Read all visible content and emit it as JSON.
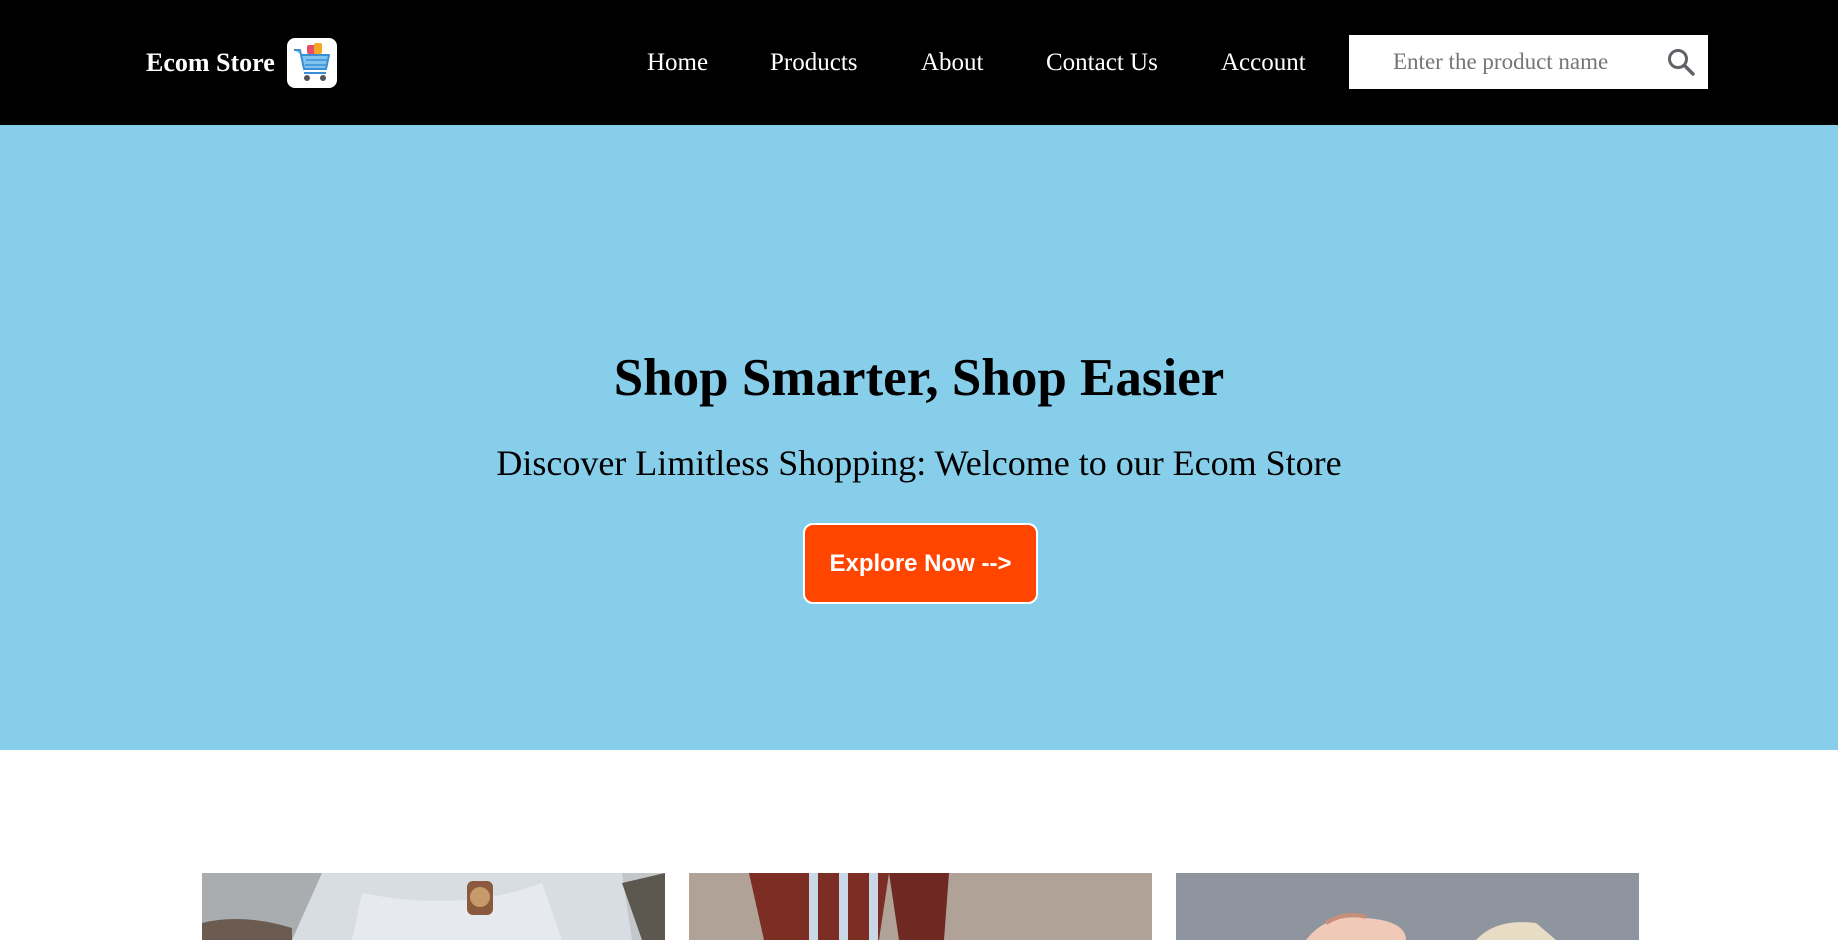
{
  "header": {
    "brand": "Ecom Store",
    "nav": [
      {
        "label": "Home"
      },
      {
        "label": "Products"
      },
      {
        "label": "About"
      },
      {
        "label": "Contact Us"
      },
      {
        "label": "Account"
      }
    ],
    "search": {
      "placeholder": "Enter the product name",
      "value": ""
    }
  },
  "hero": {
    "title": "Shop Smarter, Shop Easier",
    "subtitle": "Discover Limitless Shopping: Welcome to our Ecom Store",
    "cta": "Explore Now -->"
  },
  "colors": {
    "header_bg": "#000000",
    "hero_bg": "#87ceeb",
    "cta_bg": "#ff4500"
  },
  "icons": {
    "logo": "shopping-cart-icon",
    "search": "search-icon"
  }
}
